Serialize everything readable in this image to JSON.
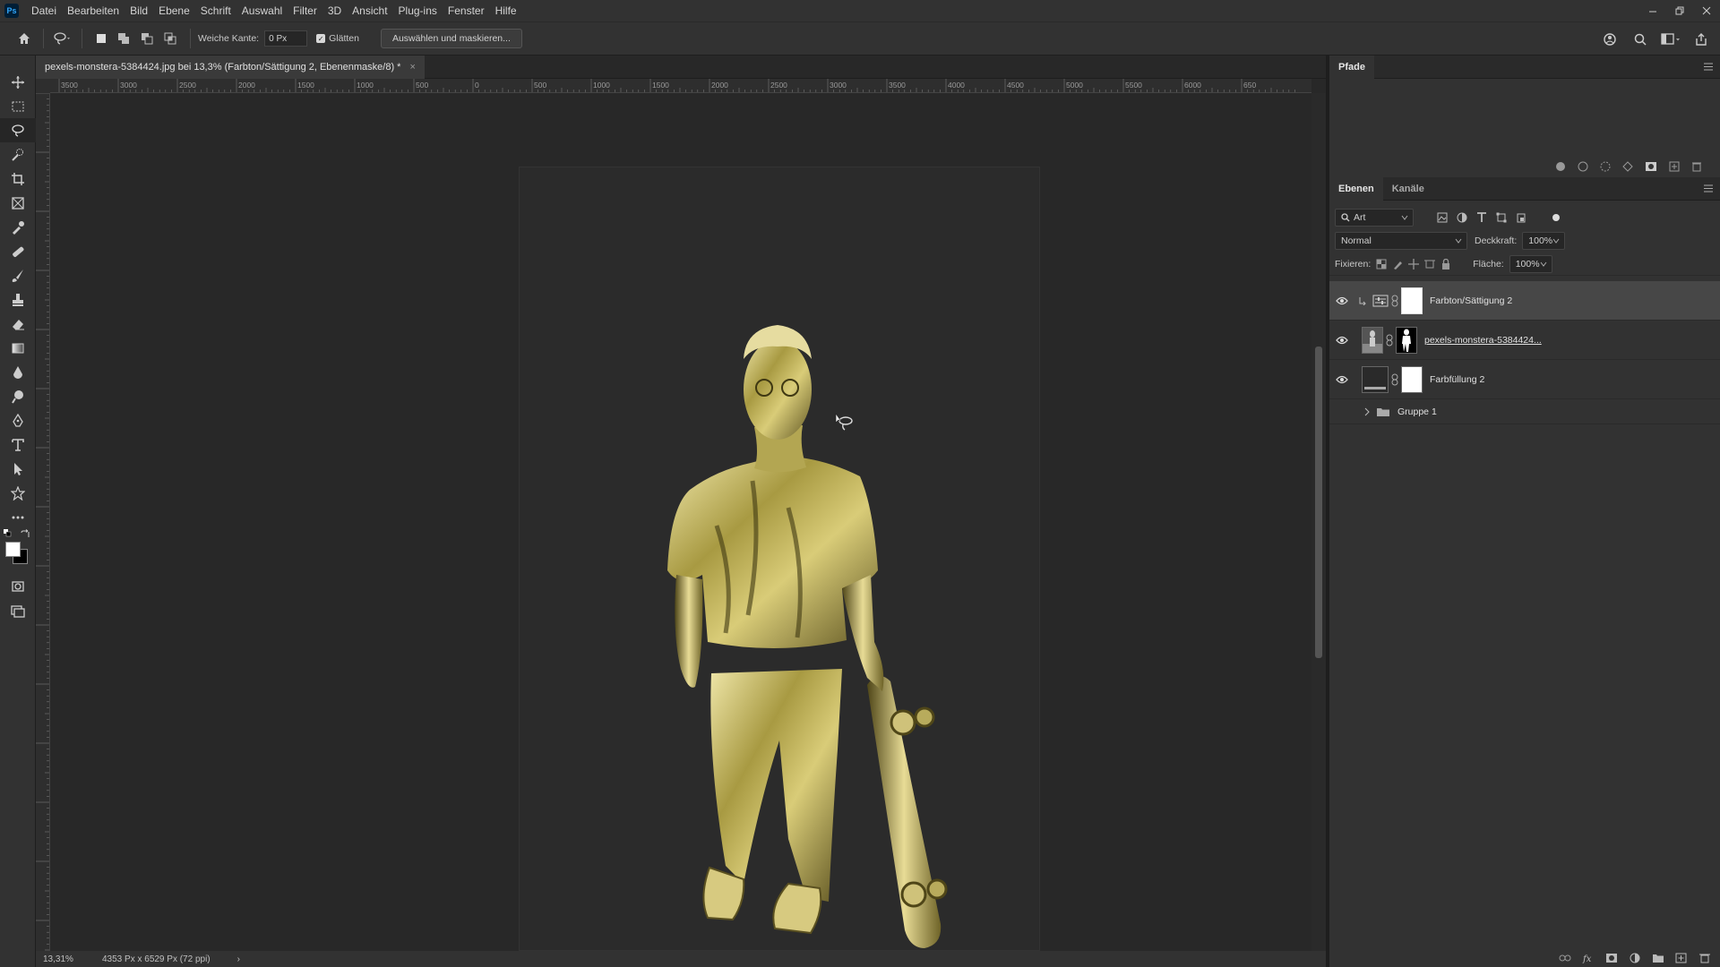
{
  "app": {
    "logo": "Ps"
  },
  "menu": [
    "Datei",
    "Bearbeiten",
    "Bild",
    "Ebene",
    "Schrift",
    "Auswahl",
    "Filter",
    "3D",
    "Ansicht",
    "Plug-ins",
    "Fenster",
    "Hilfe"
  ],
  "options": {
    "feather_label": "Weiche Kante:",
    "feather_value": "0 Px",
    "smooth_label": "Glätten",
    "select_mask_label": "Auswählen und maskieren..."
  },
  "document": {
    "tab_title": "pexels-monstera-5384424.jpg bei 13,3% (Farbton/Sättigung 2, Ebenenmaske/8) *",
    "close": "×"
  },
  "ruler_labels": [
    "3500",
    "3000",
    "2500",
    "2000",
    "1500",
    "1000",
    "500",
    "0",
    "500",
    "1000",
    "1500",
    "2000",
    "2500",
    "3000",
    "3500",
    "4000",
    "4500",
    "5000",
    "5500",
    "6000",
    "650"
  ],
  "status": {
    "zoom": "13,31%",
    "dimensions": "4353 Px x 6529 Px (72 ppi)",
    "arrow": "›"
  },
  "paths_panel": {
    "tab": "Pfade"
  },
  "layers_panel": {
    "tabs": [
      "Ebenen",
      "Kanäle"
    ],
    "filter_label": "Art",
    "blend_mode": "Normal",
    "opacity_label": "Deckkraft:",
    "opacity_value": "100%",
    "lock_label": "Fixieren:",
    "fill_label": "Fläche:",
    "fill_value": "100%",
    "layers": [
      {
        "name": "Farbton/Sättigung 2"
      },
      {
        "name": "pexels-monstera-5384424..."
      },
      {
        "name": "Farbfüllung 2"
      },
      {
        "name": "Gruppe 1"
      }
    ]
  },
  "colors": {
    "accent": "#31a8ff",
    "gold": "#c9bd6a"
  }
}
